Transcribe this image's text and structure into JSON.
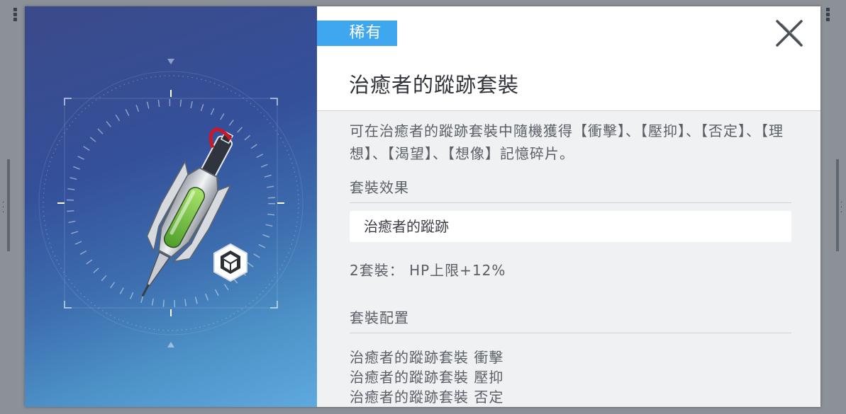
{
  "item": {
    "rarity": "稀有",
    "name": "治癒者的蹤跡套裝",
    "description": "可在治癒者的蹤跡套裝中隨機獲得【衝擊】、【壓抑】、【否定】、【理想】、【渴望】、【想像】記憶碎片。"
  },
  "set_effect": {
    "heading": "套裝效果",
    "set_name": "治癒者的蹤跡",
    "bonus": "2套裝： HP上限+12%"
  },
  "set_config": {
    "heading": "套裝配置",
    "parts": [
      "治癒者的蹤跡套裝 衝擊",
      "治癒者的蹤跡套裝 壓抑",
      "治癒者的蹤跡套裝 否定"
    ]
  },
  "icons": {
    "close": "close-x-icon",
    "category": "cube-hexagon-icon",
    "item_art": "syringe-blade-icon"
  },
  "colors": {
    "rarity_badge": "#3ea7f0",
    "art_bg_top": "#3b4a8a",
    "art_bg_bottom": "#5ea9de",
    "liquid": "#7ccf4a"
  }
}
